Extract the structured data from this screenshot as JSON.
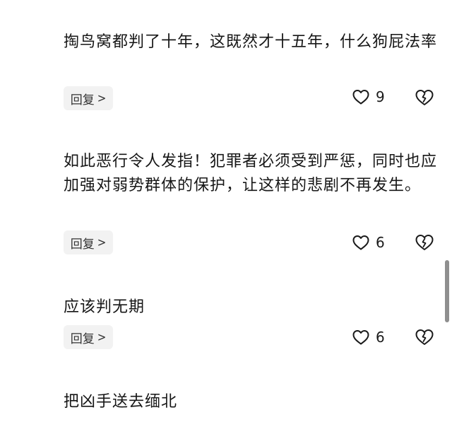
{
  "comments": [
    {
      "text": "掏鸟窝都判了十年，这既然才十五年，什么狗屁法率",
      "reply_label": "回复",
      "likes": "9",
      "icons": {
        "like": "heart-outline-icon",
        "dislike": "broken-heart-icon",
        "reply": "chevron-right-icon"
      }
    },
    {
      "text": "如此恶行令人发指！犯罪者必须受到严惩，同时也应加强对弱势群体的保护，让这样的悲剧不再发生。",
      "reply_label": "回复",
      "likes": "6",
      "icons": {
        "like": "heart-outline-icon",
        "dislike": "broken-heart-icon",
        "reply": "chevron-right-icon"
      }
    },
    {
      "text": "应该判无期",
      "reply_label": "回复",
      "likes": "6",
      "icons": {
        "like": "heart-outline-icon",
        "dislike": "broken-heart-icon",
        "reply": "chevron-right-icon"
      }
    },
    {
      "text": "把凶手送去缅北"
    }
  ],
  "colors": {
    "text": "#161616",
    "reply_bg": "#f2f2f2",
    "icon": "#1a1a1a",
    "scrollbar": "#8f8f8f"
  }
}
